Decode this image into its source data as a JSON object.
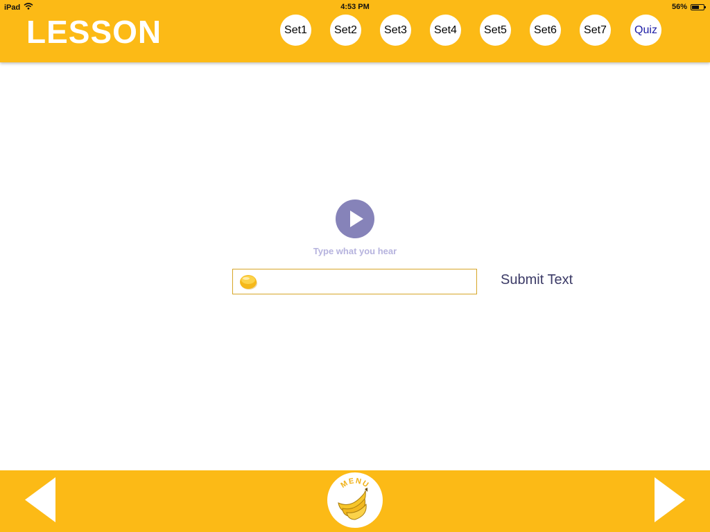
{
  "status_bar": {
    "device": "iPad",
    "time": "4:53 PM",
    "battery": "56%",
    "battery_level": 0.56
  },
  "header": {
    "title": "LESSON",
    "tabs": [
      "Set1",
      "Set2",
      "Set3",
      "Set4",
      "Set5",
      "Set6",
      "Set7",
      "Quiz"
    ]
  },
  "main": {
    "play_icon": "play-icon",
    "instruction": "Type what you hear",
    "input_value": "",
    "input_icon": "yellow-button-icon",
    "submit_label": "Submit Text"
  },
  "footer": {
    "prev_icon": "left-triangle-icon",
    "next_icon": "right-triangle-icon",
    "menu_label": "MENU",
    "menu_icon": "banana-icon"
  },
  "colors": {
    "accent": "#fcba16",
    "play_button": "#8683b9",
    "instruction_text": "#b6b3de",
    "quiz_text": "#1c1ca6",
    "submit_text": "#3b3a66"
  }
}
